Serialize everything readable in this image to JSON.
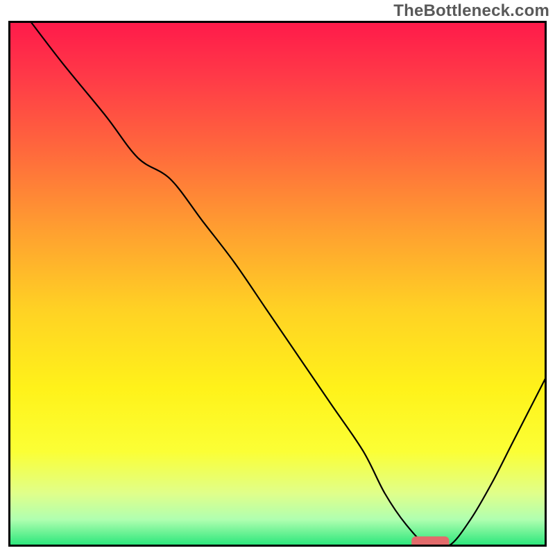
{
  "watermark": "TheBottleneck.com",
  "chart_data": {
    "type": "line",
    "title": "",
    "xlabel": "",
    "ylabel": "",
    "xlim": [
      0,
      100
    ],
    "ylim": [
      0,
      100
    ],
    "grid": false,
    "legend": false,
    "background_gradient_stops": [
      {
        "pos": 0.0,
        "color": "#ff1a4a"
      },
      {
        "pos": 0.1,
        "color": "#ff3848"
      },
      {
        "pos": 0.25,
        "color": "#ff6a3c"
      },
      {
        "pos": 0.4,
        "color": "#ffa030"
      },
      {
        "pos": 0.55,
        "color": "#ffd224"
      },
      {
        "pos": 0.7,
        "color": "#fff21a"
      },
      {
        "pos": 0.82,
        "color": "#fbff35"
      },
      {
        "pos": 0.9,
        "color": "#e0ff8a"
      },
      {
        "pos": 0.95,
        "color": "#b0ffb0"
      },
      {
        "pos": 1.0,
        "color": "#28e67a"
      }
    ],
    "series": [
      {
        "name": "main-curve",
        "color": "#000000",
        "x": [
          4,
          10,
          18,
          24,
          30,
          36,
          42,
          48,
          54,
          60,
          66,
          70,
          74,
          78,
          82,
          86,
          90,
          94,
          100
        ],
        "y": [
          100,
          92,
          82,
          74,
          70,
          62,
          54,
          45,
          36,
          27,
          18,
          10,
          4,
          0,
          0,
          5,
          12,
          20,
          32
        ]
      }
    ],
    "marker": {
      "name": "optimal-marker",
      "color": "#e26b6b",
      "x_start": 75,
      "x_end": 82,
      "y": 0.5,
      "thickness": 2.5
    }
  }
}
